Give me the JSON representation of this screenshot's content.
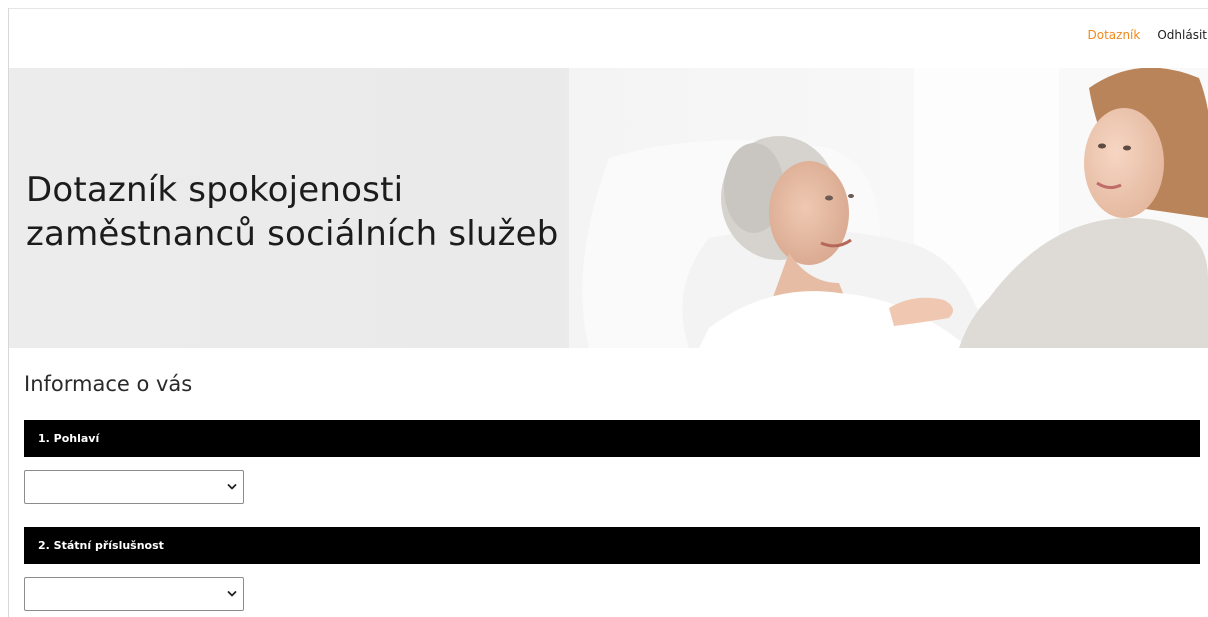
{
  "nav": {
    "active_label": "Dotazník",
    "logout_label": "Odhlásit",
    "active_color": "#f0891e"
  },
  "hero": {
    "title_line1": "Dotazník spokojenosti",
    "title_line2": "zaměstnanců sociálních služeb",
    "image_subject": "elderly woman in bed smiling with young caregiver"
  },
  "section": {
    "title": "Informace o vás"
  },
  "questions": [
    {
      "label": "1. Pohlaví",
      "selected_value": ""
    },
    {
      "label": "2. Státní příslušnost",
      "selected_value": ""
    }
  ],
  "icons": {
    "select_arrow": "chevron-down-icon"
  }
}
